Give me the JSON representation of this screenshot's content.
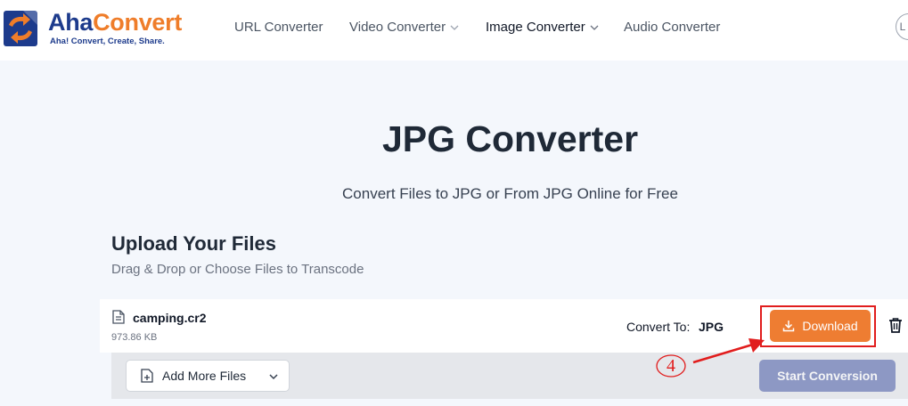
{
  "header": {
    "brand": {
      "name_part1": "Aha",
      "name_part2": "Convert",
      "tagline": "Aha! Convert, Create, Share."
    },
    "nav": [
      {
        "label": "URL Converter",
        "has_dropdown": false
      },
      {
        "label": "Video Converter",
        "has_dropdown": true
      },
      {
        "label": "Image Converter",
        "has_dropdown": true,
        "active": true
      },
      {
        "label": "Audio Converter",
        "has_dropdown": false
      }
    ],
    "login_initial": "L"
  },
  "hero": {
    "title": "JPG Converter",
    "subtitle": "Convert Files to JPG or From JPG Online for Free"
  },
  "upload": {
    "title": "Upload Your Files",
    "subtitle": "Drag & Drop or Choose Files to Transcode"
  },
  "file": {
    "name": "camping.cr2",
    "size": "973.86 KB",
    "convert_label": "Convert To:",
    "convert_value": "JPG",
    "download_label": "Download"
  },
  "actions": {
    "add_more_label": "Add More Files",
    "start_label": "Start Conversion"
  },
  "annotation": {
    "step_number": "4"
  },
  "colors": {
    "brand_blue": "#1d3b8c",
    "brand_orange": "#ef7d2a",
    "download_button": "#ee7d32",
    "start_button": "#8d98c4",
    "annotation_red": "#e11d1d"
  },
  "icons": {
    "file": "file-icon",
    "download": "download-icon",
    "delete": "trash-icon",
    "add": "file-plus-icon",
    "dropdown": "chevron-down-icon"
  }
}
